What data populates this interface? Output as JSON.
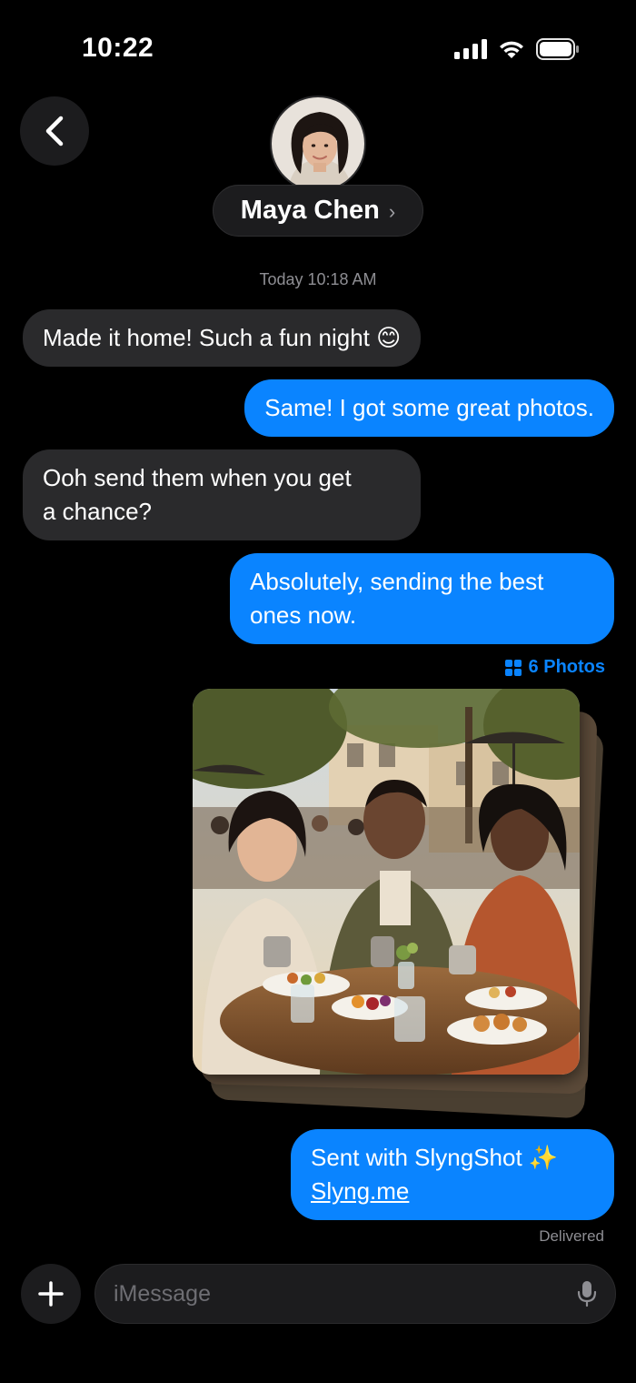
{
  "status_bar": {
    "time": "10:22"
  },
  "header": {
    "contact_name": "Maya Chen",
    "chevron": "›"
  },
  "thread": {
    "timestamp": "Today 10:18 AM",
    "messages": [
      {
        "direction": "incoming",
        "text": "Made it home! Such a fun night 😊"
      },
      {
        "direction": "outgoing",
        "text": "Same! I got some great photos."
      },
      {
        "direction": "incoming",
        "line1": "Ooh send them when you get",
        "line2": "a chance?"
      },
      {
        "direction": "outgoing",
        "line1": "Absolutely, sending the best",
        "line2": "ones now."
      }
    ],
    "photos_label": "6 Photos",
    "final_message": {
      "line1": "Sent with SlyngShot ✨",
      "link": "Slyng.me"
    },
    "status": "Delivered"
  },
  "composer": {
    "placeholder": "iMessage"
  },
  "colors": {
    "accent": "#0a84ff",
    "incoming_bubble": "#2a2a2c",
    "background": "#000000"
  },
  "icons": [
    "back-chevron-icon",
    "cellular-signal-icon",
    "wifi-icon",
    "battery-icon",
    "photo-grid-icon",
    "plus-icon",
    "microphone-icon"
  ]
}
